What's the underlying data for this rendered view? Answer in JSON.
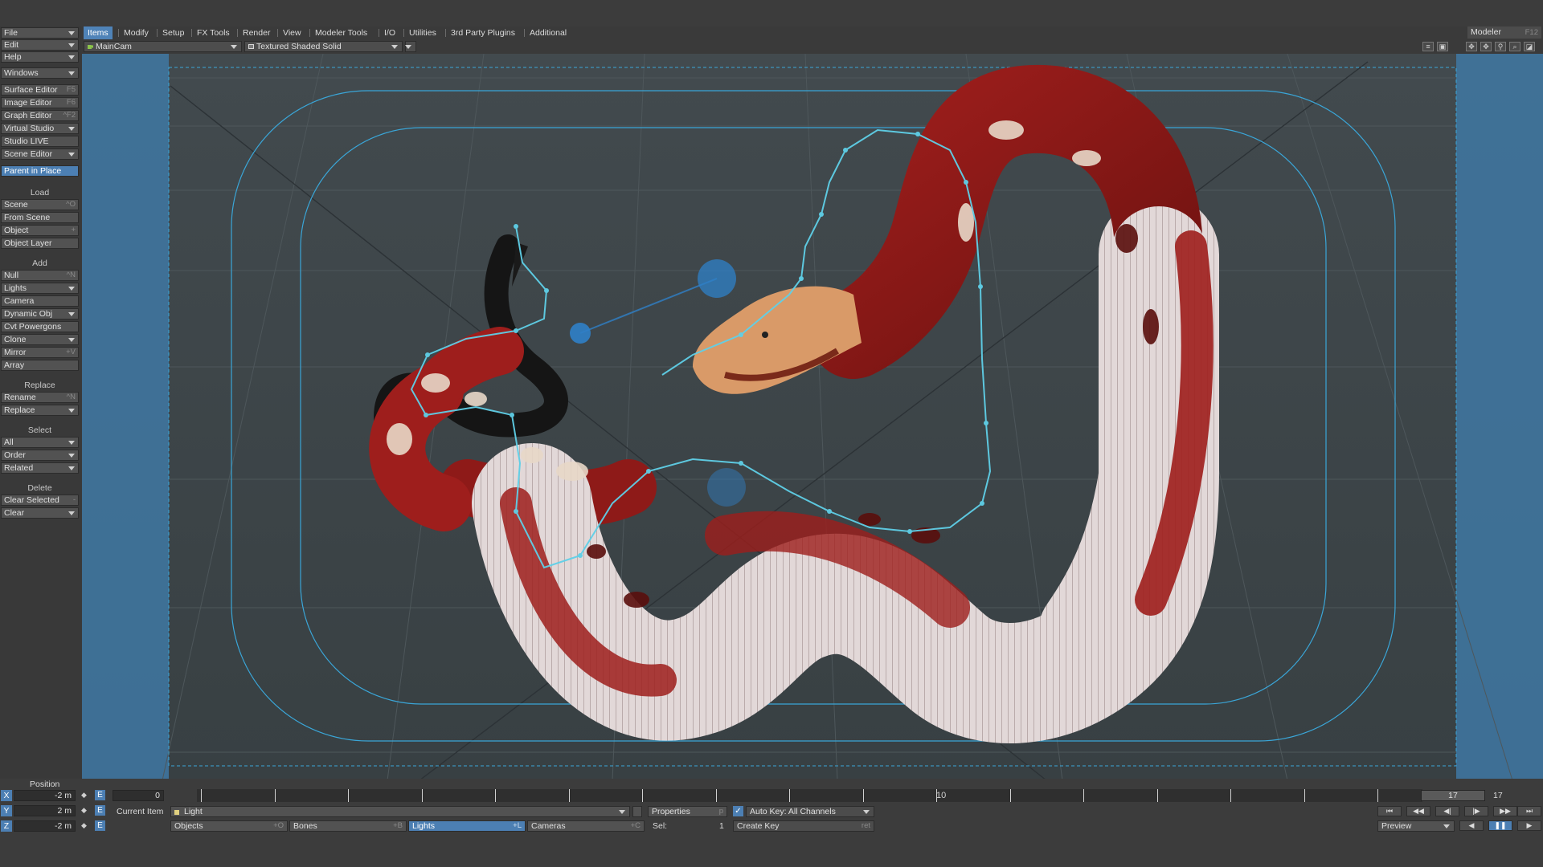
{
  "left_panel": {
    "menus": [
      {
        "label": "File"
      },
      {
        "label": "Edit"
      },
      {
        "label": "Help"
      },
      {
        "label": "Windows"
      }
    ],
    "editors": [
      {
        "label": "Surface Editor",
        "shortcut": "F5"
      },
      {
        "label": "Image Editor",
        "shortcut": "F6"
      },
      {
        "label": "Graph Editor",
        "shortcut": "^F2"
      },
      {
        "label": "Virtual Studio",
        "shortcut": ""
      },
      {
        "label": "Studio LIVE",
        "shortcut": ""
      },
      {
        "label": "Scene Editor",
        "shortcut": ""
      }
    ],
    "parent_in_place": "Parent in Place",
    "load_header": "Load",
    "load_items": [
      {
        "label": "Scene",
        "shortcut": "^O"
      },
      {
        "label": "From Scene",
        "shortcut": ""
      },
      {
        "label": "Object",
        "shortcut": "+"
      },
      {
        "label": "Object Layer",
        "shortcut": ""
      }
    ],
    "add_header": "Add",
    "add_items": [
      {
        "label": "Null",
        "shortcut": "^N"
      },
      {
        "label": "Lights",
        "shortcut": ""
      },
      {
        "label": "Camera",
        "shortcut": ""
      },
      {
        "label": "Dynamic Obj",
        "shortcut": ""
      },
      {
        "label": "Cvt Powergons",
        "shortcut": ""
      },
      {
        "label": "Clone",
        "shortcut": ""
      },
      {
        "label": "Mirror",
        "shortcut": "+V"
      },
      {
        "label": "Array",
        "shortcut": ""
      }
    ],
    "replace_header": "Replace",
    "replace_items": [
      {
        "label": "Rename",
        "shortcut": "^N"
      },
      {
        "label": "Replace",
        "shortcut": ""
      }
    ],
    "select_header": "Select",
    "select_items": [
      {
        "label": "All"
      },
      {
        "label": "Order"
      },
      {
        "label": "Related"
      }
    ],
    "delete_header": "Delete",
    "delete_items": [
      {
        "label": "Clear Selected",
        "shortcut": "-"
      },
      {
        "label": "Clear",
        "shortcut": ""
      }
    ]
  },
  "tabs": [
    "Items",
    "Modify",
    "Setup",
    "FX Tools",
    "Render",
    "View",
    "Modeler Tools",
    "I/O",
    "Utilities",
    "3rd Party Plugins",
    "Additional"
  ],
  "active_tab": "Items",
  "modeler": {
    "label": "Modeler",
    "shortcut": "F12"
  },
  "view_header": {
    "camera": "MainCam",
    "render_mode": "Textured Shaded Solid"
  },
  "bottom": {
    "position_label": "Position",
    "x_label": "X",
    "y_label": "Y",
    "z_label": "Z",
    "x_value": "-2 m",
    "y_value": "2 m",
    "z_value": "-2 m",
    "e_label": "E",
    "frame_start": "0",
    "timeline_mid_label": "10",
    "current_frame_marker": "17",
    "end_frame": "17",
    "current_item_label": "Current Item",
    "current_item_value": "Light",
    "properties": "Properties",
    "properties_sc": "p",
    "auto_key": "Auto Key: All Channels",
    "objects": "Objects",
    "objects_sc": "+O",
    "bones": "Bones",
    "bones_sc": "+B",
    "lights": "Lights",
    "lights_sc": "+L",
    "cameras": "Cameras",
    "cameras_sc": "+C",
    "sel_label": "Sel:",
    "sel_value": "1",
    "create_key": "Create Key",
    "create_key_sc": "ret",
    "preview": "Preview"
  },
  "colors": {
    "accent": "#4c7fb3",
    "viewport_bg": "#3d4548",
    "safe_area_line": "#3aa6d8",
    "overscan_band": "#3f78a3"
  },
  "icons": [
    "camera-icon",
    "shaded-solid-icon",
    "list-icon",
    "expand-icon",
    "move-icon",
    "rotate-icon",
    "zoom-icon",
    "maximize-icon",
    "play-icon",
    "pause-icon",
    "rewind-icon",
    "forward-icon"
  ]
}
